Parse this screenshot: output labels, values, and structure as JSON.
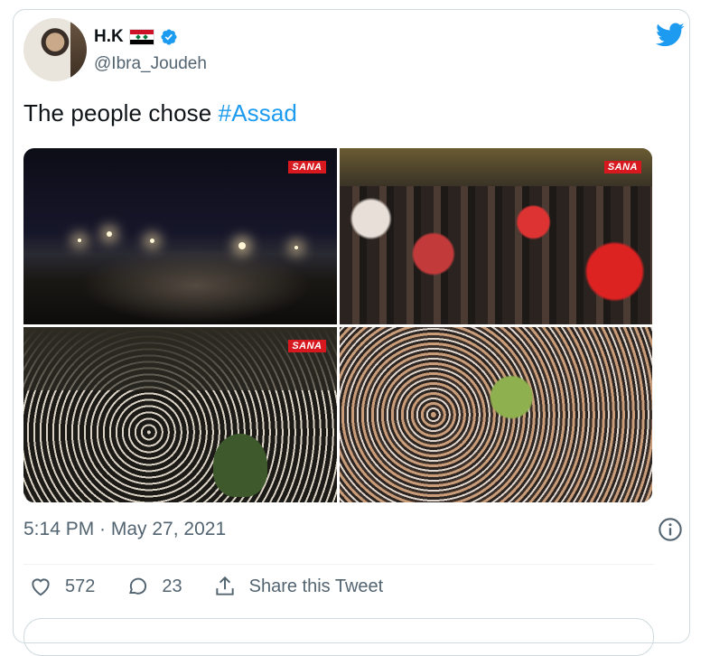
{
  "author": {
    "display_name": "H.K",
    "handle": "@Ibra_Joudeh",
    "verified": true
  },
  "icons": {
    "flag": "syria-flag-icon",
    "verified": "verified-badge-icon",
    "brand": "twitter-bird-icon",
    "info": "info-icon",
    "like": "heart-icon",
    "reply": "reply-bubble-icon",
    "share": "share-icon"
  },
  "tweet": {
    "text_prefix": "The people chose ",
    "hashtag": "#Assad"
  },
  "media": {
    "watermark": "SANA",
    "photos": [
      "night-rally-photo",
      "daytime-flag-crowd-photo",
      "night-street-crowd-photo",
      "dense-crowd-photo"
    ]
  },
  "meta": {
    "timestamp": "5:14 PM · May 27, 2021"
  },
  "actions": {
    "likes": "572",
    "replies": "23",
    "share_label": "Share this Tweet"
  },
  "colors": {
    "accent": "#1d9bf0",
    "text": "#0f1419",
    "muted": "#536471",
    "border": "#cfd9de"
  }
}
